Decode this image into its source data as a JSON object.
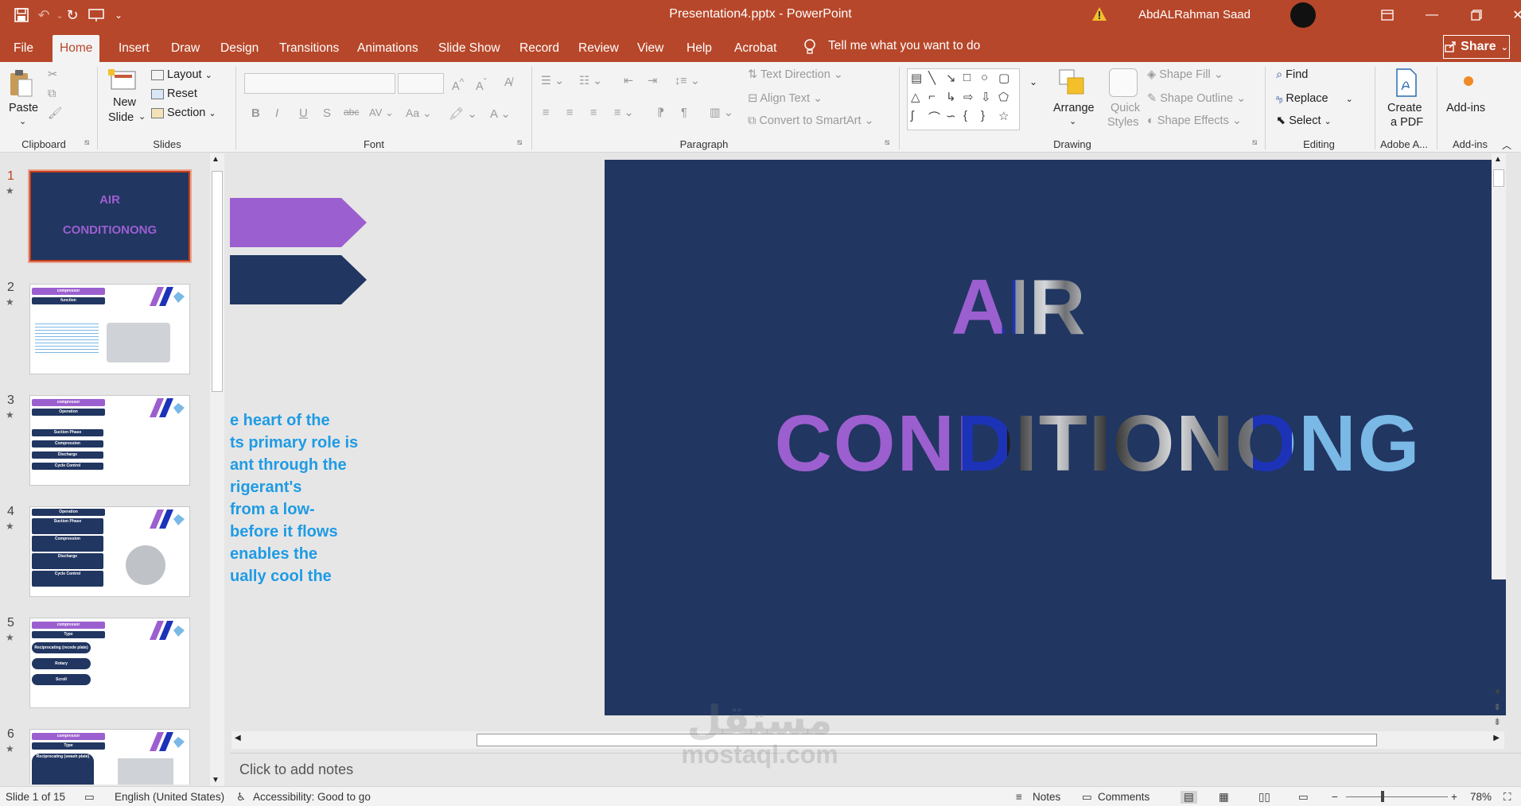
{
  "window": {
    "title": "Presentation4.pptx  -  PowerPoint",
    "user": "AbdALRahman Saad",
    "share_label": "Share",
    "tell_me": "Tell me what you want to do"
  },
  "tabs": [
    "File",
    "Home",
    "Insert",
    "Draw",
    "Design",
    "Transitions",
    "Animations",
    "Slide Show",
    "Record",
    "Review",
    "View",
    "Help",
    "Acrobat"
  ],
  "active_tab": "Home",
  "ribbon": {
    "clipboard": {
      "paste": "Paste",
      "label": "Clipboard"
    },
    "slides": {
      "new_slide_1": "New",
      "new_slide_2": "Slide",
      "layout": "Layout",
      "reset": "Reset",
      "section": "Section",
      "label": "Slides"
    },
    "font": {
      "label": "Font"
    },
    "paragraph": {
      "text_direction": "Text Direction",
      "align_text": "Align Text",
      "convert_smartart": "Convert to SmartArt",
      "label": "Paragraph"
    },
    "drawing": {
      "arrange": "Arrange",
      "quick_styles_1": "Quick",
      "quick_styles_2": "Styles",
      "shape_fill": "Shape Fill",
      "shape_outline": "Shape Outline",
      "shape_effects": "Shape Effects",
      "label": "Drawing"
    },
    "editing": {
      "find": "Find",
      "replace": "Replace",
      "select": "Select",
      "label": "Editing"
    },
    "adobe": {
      "create_pdf_1": "Create",
      "create_pdf_2": "a PDF",
      "label": "Adobe A..."
    },
    "addins": {
      "addins": "Add-ins",
      "label": "Add-ins"
    }
  },
  "thumbnails": [
    {
      "num": "1",
      "title_1": "AIR",
      "title_2": "CONDITIONONG"
    },
    {
      "num": "2",
      "pill_1": "compressor",
      "pill_2": "function"
    },
    {
      "num": "3",
      "pill_1": "compressor",
      "pill_2": "Operation",
      "items": [
        "Suction Phase",
        "Compression",
        "Discharge",
        "Cycle Control"
      ]
    },
    {
      "num": "4",
      "pill_1": "Operation",
      "items": [
        "Suction Phase",
        "Compression",
        "Discharge",
        "Cycle Control"
      ]
    },
    {
      "num": "5",
      "pill_1": "compressor",
      "pill_2": "Type",
      "items": [
        "Reciprocating (recede plate)",
        "Rotary",
        "Scroll"
      ]
    },
    {
      "num": "6",
      "pill_1": "compressor",
      "pill_2": "Type",
      "items": [
        "Reciprocating (swash plate)"
      ]
    }
  ],
  "slide": {
    "title_1": "AIR",
    "title_2": "CONDITIONONG",
    "overflow_lines": [
      "e heart of the",
      "ts primary role is",
      "ant through the",
      "rigerant's",
      "from a low-",
      "before it flows",
      " enables the",
      "ually cool the"
    ],
    "colors": {
      "background": "#213661",
      "purple": "#9c5fcf",
      "blue": "#1c33b8",
      "light_blue": "#7ab8e6",
      "text_blue": "#1f9be4"
    }
  },
  "notes": {
    "placeholder": "Click to add notes"
  },
  "status": {
    "slide_counter": "Slide 1 of 15",
    "language": "English (United States)",
    "accessibility": "Accessibility: Good to go",
    "notes": "Notes",
    "comments": "Comments",
    "zoom": "78%"
  },
  "watermark": {
    "arabic": "مستقل",
    "latin": "mostaql.com"
  }
}
